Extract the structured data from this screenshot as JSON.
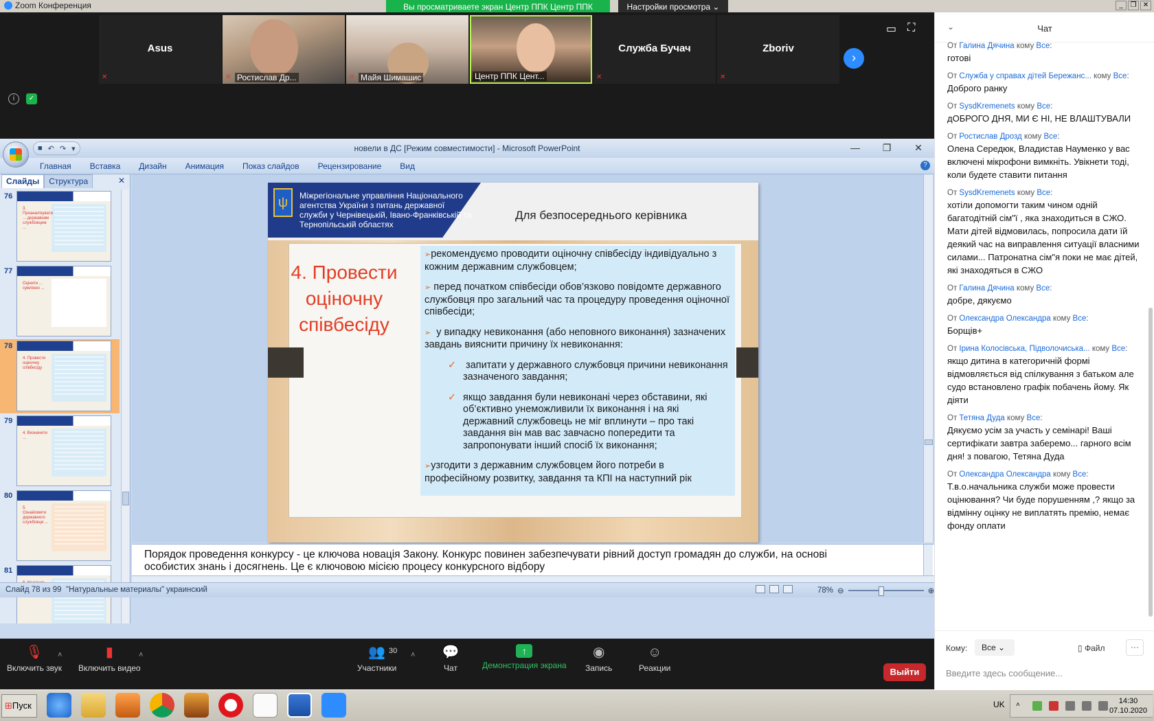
{
  "zoom": {
    "window_title": "Zoom Конференция",
    "share_banner": "Вы просматриваете экран Центр ППК Центр ППК",
    "view_options": "Настройки просмотра ⌄",
    "participants": [
      {
        "name": "Asus",
        "video": false
      },
      {
        "name": "Ростислав Др...",
        "video": true
      },
      {
        "name": "Майя Шимашис",
        "video": true
      },
      {
        "name": "Центр ППК Цент...",
        "video": true
      },
      {
        "name": "Служба Бучач",
        "video": false
      },
      {
        "name": "Zboriv",
        "video": false
      }
    ],
    "toolbar": {
      "mic": "Включить звук",
      "video": "Включить видео",
      "participants": "Участники",
      "participants_count": "30",
      "chat": "Чат",
      "share": "Демонстрация экрана",
      "record": "Запись",
      "reactions": "Реакции",
      "exit": "Выйти"
    }
  },
  "ppt": {
    "window_title": "новели в ДС [Режим совместимости] - Microsoft PowerPoint",
    "ribbon_tabs": [
      "Главная",
      "Вставка",
      "Дизайн",
      "Анимация",
      "Показ слайдов",
      "Рецензирование",
      "Вид"
    ],
    "panel_tabs": [
      "Слайды",
      "Структура"
    ],
    "thumbs": [
      {
        "num": "76",
        "red": "3. Проаналізувати ... державним службовцем ...",
        "selected": false
      },
      {
        "num": "77",
        "red": "Оцінити ... сумлінно ...",
        "selected": false
      },
      {
        "num": "78",
        "red": "4. Провести оціночну співбесіду",
        "selected": true
      },
      {
        "num": "79",
        "red": "4. Визначити ...",
        "selected": false
      },
      {
        "num": "80",
        "red": "5. Ознайомити державного службовця ...",
        "selected": false
      },
      {
        "num": "81",
        "red": "6. Надання ...",
        "selected": false
      }
    ],
    "slide": {
      "org": "Міжрегіональне управління Національного агентства України з питань державної служби у Чернівецькій, Івано-Франківській та Тернопільській областях",
      "header": "Для безпосереднього керівника",
      "step_title": "4. Провести оціночну співбесіду",
      "bullets": [
        "рекомендуємо проводити оціночну співбесіду індивідуально з кожним державним службовцем;",
        "перед початком співбесіди обов’язково повідомте державного службовця про загальний час та процедуру проведення оціночної співбесіди;",
        "у випадку невиконання (або неповного виконання) зазначених завдань вияснити причину їх невиконання:"
      ],
      "sub_bullets": [
        "запитати у державного службовця причини невиконання зазначеного завдання;",
        "якщо завдання були невиконані через обставини, які об’єктивно унеможливили їх виконання і на які державний службовець не міг вплинути – про такі завдання він мав вас завчасно попередити та запропонувати інший спосіб їх виконання;"
      ],
      "last_bullet": "узгодити з державним службовцем його потреби в професійному розвитку, завдання та КПІ на наступний рік"
    },
    "notes": "Порядок проведення  конкурсу - це ключова новація Закону. Конкурс повинен забезпечувати рівний доступ громадян до служби, на основі особистих знань і досягнень. Це є ключовою місією процесу конкурсного відбору",
    "status": {
      "slide_of": "Слайд 78 из 99",
      "theme": "\"Натуральные материалы\"",
      "language": "украинский",
      "zoom": "78%"
    }
  },
  "chat": {
    "title": "Чат",
    "messages": [
      {
        "from": "Галина Дячина",
        "to": "Все",
        "text": "готові"
      },
      {
        "from": "Служба у справах дітей Бережанс...",
        "to": "Все",
        "text": "Доброго ранку"
      },
      {
        "from": "SysdKremenets",
        "to": "Все",
        "text": "дОБРОГО ДНЯ, МИ Є НІ, НЕ ВЛАШТУВАЛИ"
      },
      {
        "from": "Ростислав Дрозд",
        "to": "Все",
        "text": "Олена Середюк, Владистав Науменко  у вас включені мікрофони вимкніть. Увікнети тоді, коли будете ставити питання"
      },
      {
        "from": "SysdKremenets",
        "to": "Все",
        "text": "хотіли допомогти таким чином одній багатодітній сім\"ї , яка знаходиться в СЖО. Мати дітей відмовилась, попросила дати їй деякий час на виправлення ситуації власними силами... Патронатна сім\"я поки не має дітей, які знаходяться в СЖО"
      },
      {
        "from": "Галина Дячина",
        "to": "Все",
        "text": "добре, дякуємо"
      },
      {
        "from": "Олександра Олександра",
        "to": "Все",
        "text": "Борщів+"
      },
      {
        "from": "Ірина Колосівська, Підволочиська...",
        "to": "Все",
        "text": "якщо дитина в категоричній формі відмовляється від спілкування з батьком але судо встановлено графік побачень йому. Як діяти"
      },
      {
        "from": "Тетяна Дуда",
        "to": "Все",
        "text": "Дякуємо усім за участь у семінарі! Ваші сертифікати завтра заберемо... гарного всім дня! з повагою, Тетяна Дуда"
      },
      {
        "from": "Олександра Олександра",
        "to": "Все",
        "text": "Т.в.о.начальника служби може провести оцінювання? Чи буде  порушенням ,? якщо за відмінну оцінку  не виплатять премію, немає фонду оплати"
      }
    ],
    "from_label": "От",
    "to_label": "кому",
    "compose": {
      "to_label": "Кому:",
      "to_value": "Все",
      "file_label": "Файл",
      "placeholder": "Введите здесь сообщение..."
    }
  },
  "taskbar": {
    "start": "Пуск",
    "lang": "UK",
    "time": "14:30",
    "date": "07.10.2020"
  }
}
